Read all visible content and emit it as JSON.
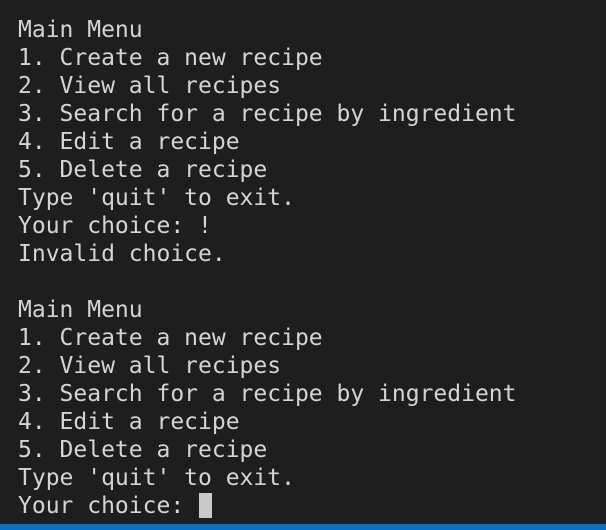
{
  "terminal": {
    "first_block": {
      "menu_title": "Main Menu",
      "options": [
        "1. Create a new recipe",
        "2. View all recipes",
        "3. Search for a recipe by ingredient",
        "4. Edit a recipe",
        "5. Delete a recipe"
      ],
      "quit_hint": "Type 'quit' to exit.",
      "prompt": "Your choice: !",
      "error": "Invalid choice."
    },
    "second_block": {
      "menu_title": "Main Menu",
      "options": [
        "1. Create a new recipe",
        "2. View all recipes",
        "3. Search for a recipe by ingredient",
        "4. Edit a recipe",
        "5. Delete a recipe"
      ],
      "quit_hint": "Type 'quit' to exit.",
      "prompt": "Your choice: "
    },
    "colors": {
      "background": "#1e1e1e",
      "text": "#d4d4d4",
      "cursor": "#c9c9c9",
      "status_bar": "#0a6fc2"
    }
  }
}
